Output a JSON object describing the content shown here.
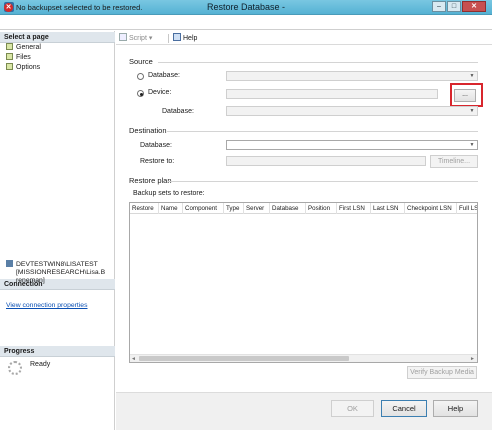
{
  "window": {
    "title": "Restore Database -",
    "minimize_glyph": "–",
    "maximize_glyph": "□",
    "close_glyph": "✕"
  },
  "error_banner": {
    "icon": "error-icon",
    "icon_glyph": "✕",
    "message": "No backupset selected to be restored."
  },
  "left_pane": {
    "select_page_header": "Select a page",
    "pages": [
      {
        "label": "General",
        "icon": "page-icon"
      },
      {
        "label": "Files",
        "icon": "page-icon"
      },
      {
        "label": "Options",
        "icon": "page-icon"
      }
    ],
    "connection_header": "Connection",
    "connection_server": "DEVTESTWIN8\\LISATEST",
    "connection_user": "[MISSIONRESEARCH\\Lisa.Breneman]",
    "view_connection_link": "View connection properties",
    "progress_header": "Progress",
    "progress_status": "Ready"
  },
  "toolbar": {
    "script_label": "Script",
    "script_arrow": "▾",
    "help_label": "Help"
  },
  "source": {
    "section_label": "Source",
    "database_radio_label": "Database:",
    "device_radio_label": "Device:",
    "device_database_label": "Database:",
    "browse_button_label": "...",
    "selected_option": "Device"
  },
  "destination": {
    "section_label": "Destination",
    "database_label": "Database:",
    "restore_to_label": "Restore to:",
    "timeline_button_label": "Timeline..."
  },
  "restore_plan": {
    "section_label": "Restore plan",
    "backup_sets_label": "Backup sets to restore:",
    "columns": [
      "Restore",
      "Name",
      "Component",
      "Type",
      "Server",
      "Database",
      "Position",
      "First LSN",
      "Last LSN",
      "Checkpoint LSN",
      "Full LS"
    ],
    "rows": [],
    "scroll_left_glyph": "◄",
    "scroll_right_glyph": "►",
    "verify_button_label": "Verify Backup Media"
  },
  "footer": {
    "ok_label": "OK",
    "cancel_label": "Cancel",
    "help_label": "Help"
  },
  "colors": {
    "title_bar": "#55b2d4",
    "error_icon": "#d42a2a",
    "highlight_box": "#d8262d",
    "link": "#0a4fb3"
  }
}
